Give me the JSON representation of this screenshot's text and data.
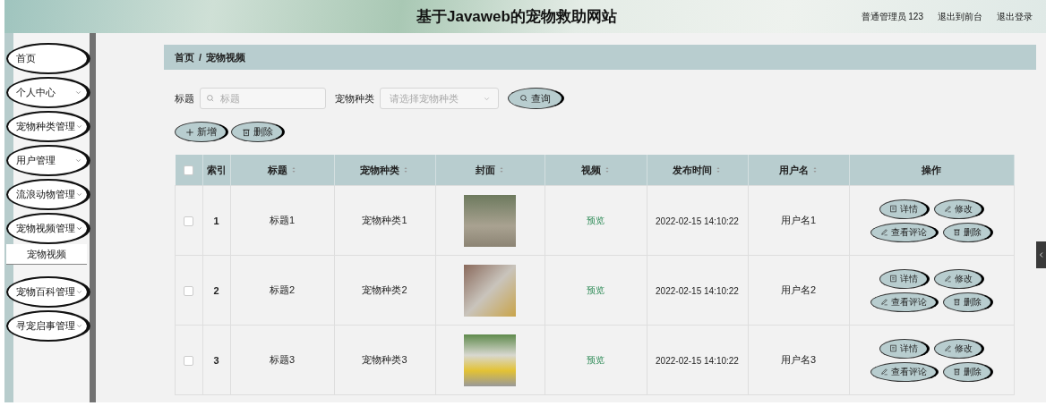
{
  "header": {
    "title": "基于Javaweb的宠物救助网站",
    "user": "普通管理员 123",
    "links": [
      "退出到前台",
      "退出登录"
    ]
  },
  "sidebar": {
    "items": [
      {
        "label": "首页",
        "kind": "link"
      },
      {
        "label": "个人中心",
        "kind": "group",
        "expanded": false
      },
      {
        "label": "宠物种类管理",
        "kind": "group",
        "expanded": false
      },
      {
        "label": "用户管理",
        "kind": "group",
        "expanded": false
      },
      {
        "label": "流浪动物管理",
        "kind": "group",
        "expanded": false
      },
      {
        "label": "宠物视频管理",
        "kind": "group",
        "expanded": true,
        "children": [
          {
            "label": "宠物视频",
            "selected": true
          }
        ]
      },
      {
        "label": "宠物百科管理",
        "kind": "group",
        "expanded": false
      },
      {
        "label": "寻宠启事管理",
        "kind": "group",
        "expanded": false
      }
    ]
  },
  "breadcrumb": {
    "items": [
      "首页",
      "宠物视频"
    ],
    "separator": "/"
  },
  "search": {
    "fields": [
      {
        "label": "标题",
        "kind": "text",
        "placeholder": "标题"
      },
      {
        "label": "宠物种类",
        "kind": "select",
        "placeholder": "请选择宠物种类"
      }
    ],
    "button": "查询"
  },
  "toolbar": [
    {
      "label": "新增",
      "kind": "add"
    },
    {
      "label": "删除",
      "kind": "delete"
    }
  ],
  "table": {
    "columns": [
      {
        "kind": "checkbox",
        "checked": false
      },
      {
        "label": "索引",
        "sortable": false
      },
      {
        "label": "标题",
        "sortable": true
      },
      {
        "label": "宠物种类",
        "sortable": true
      },
      {
        "label": "封面",
        "sortable": true
      },
      {
        "label": "视频",
        "sortable": true
      },
      {
        "label": "发布时间",
        "sortable": true
      },
      {
        "label": "用户名",
        "sortable": true
      },
      {
        "label": "操作",
        "sortable": false
      }
    ],
    "rows": [
      {
        "checked": false,
        "index": "1",
        "title": "标题1",
        "category": "宠物种类1",
        "video": "预览",
        "time": "2022-02-15 14:10:22",
        "user": "用户名1",
        "actions": [
          {
            "label": "详情",
            "kind": "detail"
          },
          {
            "label": "修改",
            "kind": "edit"
          },
          {
            "label": "查看评论",
            "kind": "edit"
          },
          {
            "label": "删除",
            "kind": "delete"
          }
        ]
      },
      {
        "checked": false,
        "index": "2",
        "title": "标题2",
        "category": "宠物种类2",
        "video": "预览",
        "time": "2022-02-15 14:10:22",
        "user": "用户名2",
        "actions": [
          {
            "label": "详情",
            "kind": "detail"
          },
          {
            "label": "修改",
            "kind": "edit"
          },
          {
            "label": "查看评论",
            "kind": "edit"
          },
          {
            "label": "删除",
            "kind": "delete"
          }
        ]
      },
      {
        "checked": false,
        "index": "3",
        "title": "标题3",
        "category": "宠物种类3",
        "video": "预览",
        "time": "2022-02-15 14:10:22",
        "user": "用户名3",
        "actions": [
          {
            "label": "详情",
            "kind": "detail"
          },
          {
            "label": "修改",
            "kind": "edit"
          },
          {
            "label": "查看评论",
            "kind": "edit"
          },
          {
            "label": "删除",
            "kind": "delete"
          }
        ]
      }
    ]
  }
}
